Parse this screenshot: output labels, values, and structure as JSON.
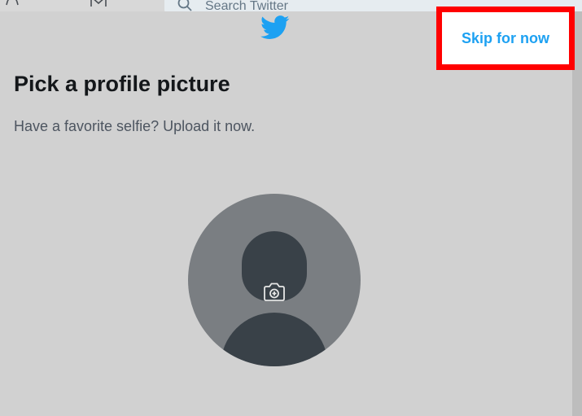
{
  "header": {
    "search_placeholder": "Search Twitter"
  },
  "icons": {
    "bell": "bell-icon",
    "mail": "mail-icon",
    "search": "search-icon",
    "logo": "twitter-bird-icon",
    "camera": "camera-plus-icon"
  },
  "modal": {
    "skip_label": "Skip for now",
    "title": "Pick a profile picture",
    "subtitle": "Have a favorite selfie? Upload it now."
  },
  "colors": {
    "brand_blue": "#1da1f2",
    "highlight_red": "#ff0000",
    "modal_bg": "#d1d1d1",
    "avatar_bg": "#7a7e82",
    "avatar_figure": "#394148"
  }
}
